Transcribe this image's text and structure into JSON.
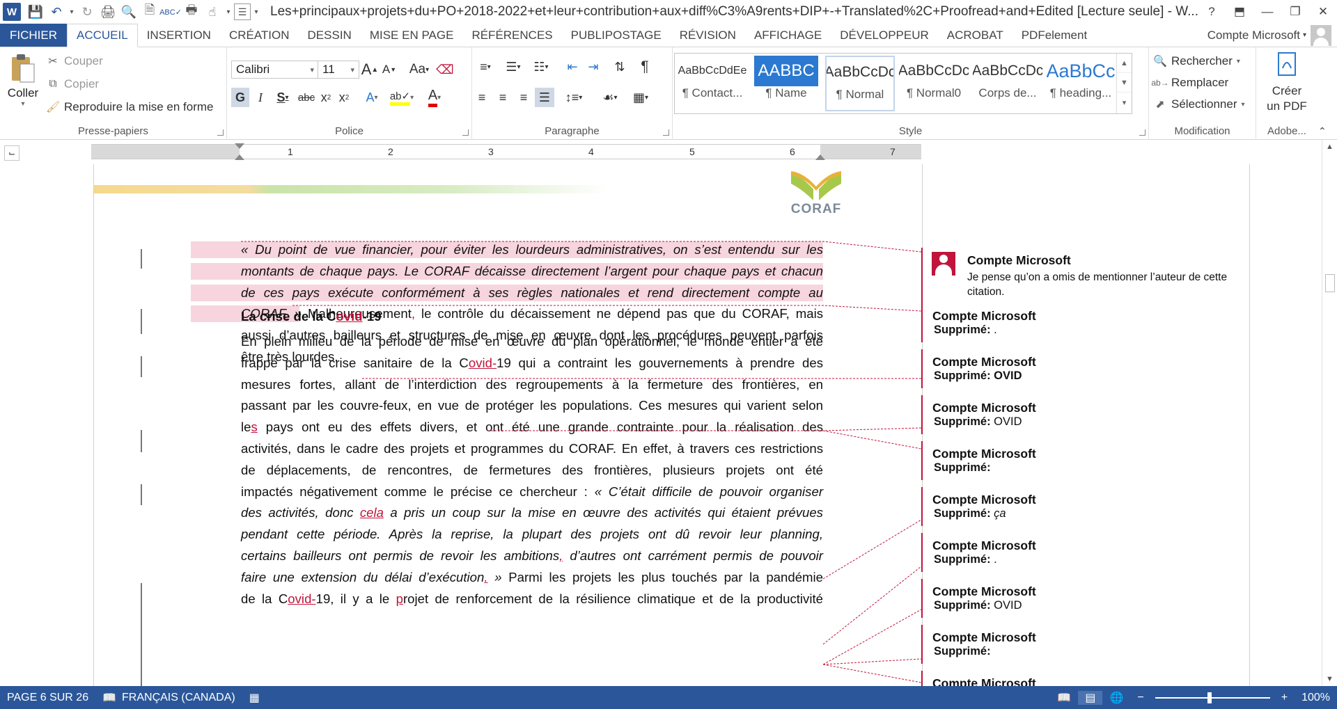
{
  "titlebar": {
    "app_icon": "W",
    "title": "Les+principaux+projets+du+PO+2018-2022+et+leur+contribution+aux+diff%C3%A9rents+DIP+-+Translated%2C+Proofread+and+Edited [Lecture seule] - W...",
    "help": "?",
    "restore_ribbon": "⬒",
    "minimize": "—",
    "maximize": "❐",
    "close": "✕"
  },
  "tabs": {
    "items": [
      "FICHIER",
      "ACCUEIL",
      "INSERTION",
      "CRÉATION",
      "DESSIN",
      "MISE EN PAGE",
      "RÉFÉRENCES",
      "PUBLIPOSTAGE",
      "RÉVISION",
      "AFFICHAGE",
      "DÉVELOPPEUR",
      "ACROBAT",
      "PDFelement"
    ],
    "active": "ACCUEIL",
    "account": "Compte Microsoft"
  },
  "ribbon": {
    "clipboard": {
      "label": "Presse-papiers",
      "paste": "Coller",
      "cut": "Couper",
      "copy": "Copier",
      "format_painter": "Reproduire la mise en forme"
    },
    "font": {
      "label": "Police",
      "font_name": "Calibri",
      "font_size": "11"
    },
    "paragraph": {
      "label": "Paragraphe"
    },
    "styles": {
      "label": "Style",
      "items": [
        {
          "preview": "AaBbCcDdEe",
          "name": "¶ Contact..."
        },
        {
          "preview": "AABBC",
          "name": "¶ Name"
        },
        {
          "preview": "AaBbCcDc",
          "name": "¶ Normal"
        },
        {
          "preview": "AaBbCcDc",
          "name": "¶ Normal0"
        },
        {
          "preview": "AaBbCcDc",
          "name": "Corps de..."
        },
        {
          "preview": "AaBbCc",
          "name": "¶ heading..."
        }
      ]
    },
    "editing": {
      "label": "Modification",
      "find": "Rechercher",
      "replace": "Remplacer",
      "select": "Sélectionner"
    },
    "adobe": {
      "label": "Adobe...",
      "create_pdf_1": "Créer",
      "create_pdf_2": "un PDF"
    }
  },
  "ruler": {
    "numbers": [
      "1",
      "2",
      "3",
      "4",
      "5",
      "6",
      "7"
    ]
  },
  "document": {
    "logo_text": "CORAF",
    "quote_lines": [
      "« Du point de vue financier, pour éviter les lourdeurs administratives, on s’est entendu sur les",
      "montants de chaque pays. Le CORAF décaisse directement l’argent pour chaque pays et chacun",
      "de ces pays exécute conformément à ses règles nationales et rend directement compte au"
    ],
    "p1_line4_quote": "CORAF",
    "p1_line4_mark": ".",
    "p1_line4_close": " »",
    "p1_line4_rest_a": " Malheureusement",
    "p1_line4_comma": ",",
    "p1_line4_rest_b": " le contrôle du décaissement ne dépend pas que du CORAF, mais",
    "p1_line5": "aussi d’autres bailleurs et structures de mise en œuvre dont les procédures peuvent parfois",
    "p1_line6": "être très lourdes.",
    "heading_a": "La crise de la C",
    "heading_ins": "ovid",
    "heading_b": "-19",
    "p2_l1": "En plein milieu de la période de mise en œuvre du plan opérationnel, le monde entier a été",
    "p2_l2a": "frappé par la crise sanitaire de la C",
    "p2_l2ins": "ovid-",
    "p2_l2b": "19 qui a contraint les gouvernements à prendre des",
    "p2_l3": "mesures fortes, allant de l’interdiction des regroupements à la fermeture des frontières, en",
    "p2_l4": "passant par les couvre-feux, en vue de protéger les populations. Ces mesures qui varient selon",
    "p2_l5a": "le",
    "p2_l5ins": "s",
    "p2_l5b": " pays ont eu des effets divers, et ont été une grande contrainte pour la réalisation des",
    "p2_l6": "activités, dans le cadre des projets et programmes du CORAF. En effet, à travers ces restrictions",
    "p2_l7": "de déplacements, de rencontres, de fermetures des frontières, plusieurs projets ont été",
    "p2_l8a": "impactés négativement comme le précise ce chercheur : ",
    "p2_l8b": "« C’était difficile de pouvoir organiser",
    "p2_l9a": "des activités, donc ",
    "p2_l9ins": "cela",
    "p2_l9b": " a pris un coup sur la mise en œuvre des activités qui étaient prévues",
    "p2_l10": "pendant cette période. Après la reprise, la plupart des projets ont dû revoir leur planning,",
    "p2_l11a": "certains bailleurs ont permis de revoir les ambitions",
    "p2_l11ins": ",",
    "p2_l11b": " d’autres ont carrément permis de pouvoir",
    "p2_l12a": "faire une extension du délai d’exécution",
    "p2_l12ins": ".",
    "p2_l12b": " »",
    "p2_l12c": " Parmi les projets les plus touchés par la pandémie",
    "p2_l13a": "de la C",
    "p2_l13ins": "ovid-",
    "p2_l13b": "19, il y a le ",
    "p2_l13ins2": "p",
    "p2_l13c": "rojet de renforcement de la résilience climatique et de la productivité"
  },
  "comments": {
    "first": {
      "author": "Compte Microsoft",
      "text": "Je pense qu’on a omis de mentionner l’auteur de cette citation."
    },
    "deletions": [
      {
        "author": "Compte Microsoft",
        "label": "Supprimé:",
        "value": " ."
      },
      {
        "author": "Compte Microsoft",
        "label": "Supprimé:",
        "value": " OVID"
      },
      {
        "author": "Compte Microsoft",
        "label": "Supprimé:",
        "value": " OVID"
      },
      {
        "author": "Compte Microsoft",
        "label": "Supprimé:",
        "value": ""
      },
      {
        "author": "Compte Microsoft",
        "label": "Supprimé:",
        "value": " ça"
      },
      {
        "author": "Compte Microsoft",
        "label": "Supprimé:",
        "value": " ."
      },
      {
        "author": "Compte Microsoft",
        "label": "Supprimé:",
        "value": " OVID"
      },
      {
        "author": "Compte Microsoft",
        "label": "Supprimé:",
        "value": ""
      },
      {
        "author": "Compte Microsoft",
        "label": "",
        "value": ""
      }
    ]
  },
  "statusbar": {
    "page": "PAGE 6 SUR 26",
    "language": "FRANÇAIS (CANADA)",
    "zoom": "100%",
    "zoom_minus": "−",
    "zoom_plus": "+"
  },
  "colors": {
    "accent": "#2b579a",
    "revision": "#c0143c",
    "highlight": "#f7d5de"
  }
}
